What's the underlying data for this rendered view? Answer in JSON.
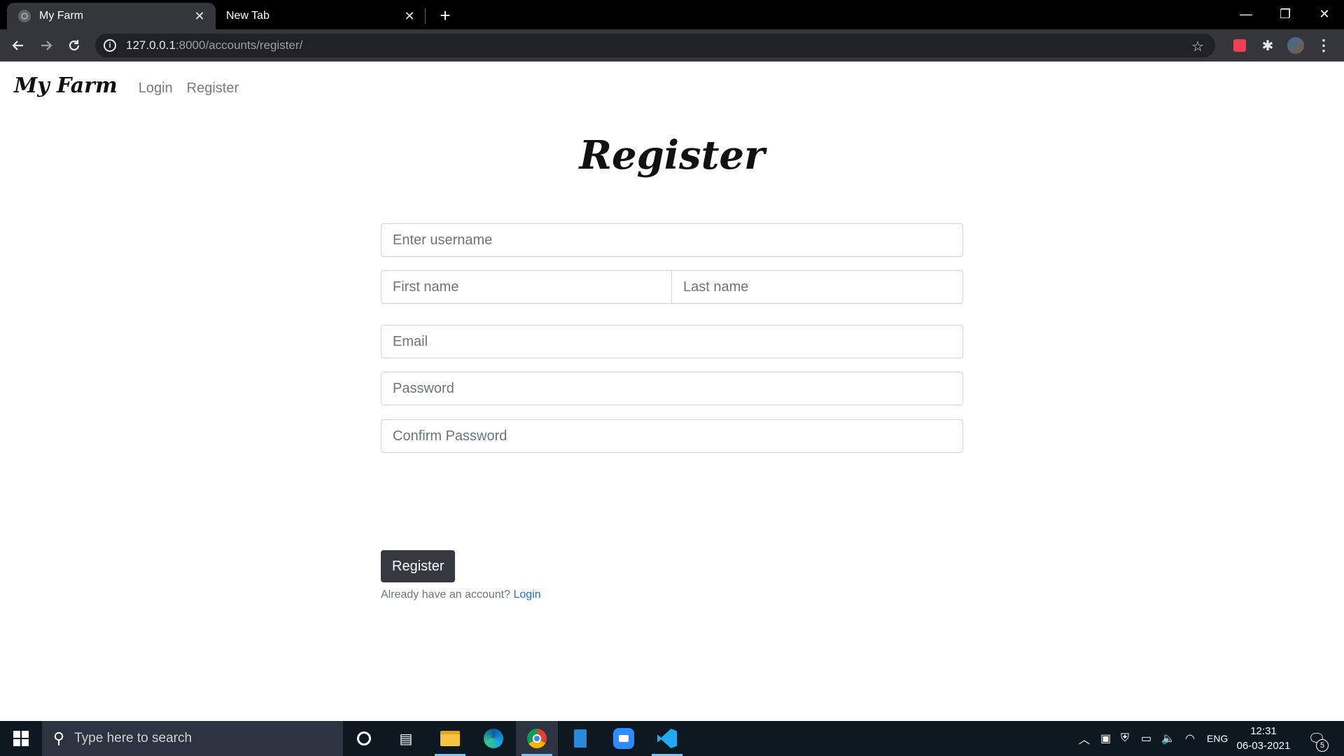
{
  "browser": {
    "tabs": [
      {
        "title": "My Farm",
        "active": true
      },
      {
        "title": "New Tab",
        "active": false
      }
    ],
    "tab_close_glyph": "✕",
    "new_tab_glyph": "+",
    "window_controls": {
      "minimize": "—",
      "restore": "❐",
      "close": "✕"
    },
    "address": {
      "host": "127.0.0.1",
      "rest": ":8000/accounts/register/"
    },
    "icons": [
      "back-icon",
      "forward-icon",
      "reload-icon",
      "site-info-icon",
      "bookmark-star-icon",
      "pocket-icon",
      "extensions-icon",
      "profile-avatar-icon",
      "menu-icon"
    ]
  },
  "navbar": {
    "brand": "My Farm",
    "links": [
      "Login",
      "Register"
    ]
  },
  "page": {
    "title": "Register"
  },
  "form": {
    "username_placeholder": "Enter username",
    "first_name_placeholder": "First name",
    "last_name_placeholder": "Last name",
    "email_placeholder": "Email",
    "password_placeholder": "Password",
    "confirm_password_placeholder": "Confirm Password",
    "submit_label": "Register",
    "account_prompt": "Already have an account?",
    "login_link": "Login"
  },
  "taskbar": {
    "search_placeholder": "Type here to search",
    "pinned_apps": [
      "cortana-icon",
      "task-view-icon",
      "file-explorer-icon",
      "edge-icon",
      "chrome-icon",
      "notepad-icon",
      "zoom-icon",
      "vscode-icon"
    ],
    "tray": {
      "language": "ENG",
      "time": "12:31",
      "date": "06-03-2021",
      "notification_count": "5"
    }
  },
  "colors": {
    "button_dark": "#343a40",
    "link_blue": "#1a73e8",
    "tab_active": "#35363a",
    "taskbar": "#0d1821"
  }
}
